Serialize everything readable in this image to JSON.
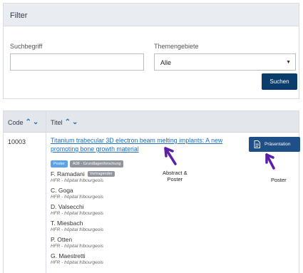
{
  "filter": {
    "title": "Filter",
    "search_label": "Suchbegriff",
    "search_value": "",
    "topic_label": "Themengebiete",
    "topic_selected": "Alle",
    "search_button": "Suchen"
  },
  "table": {
    "columns": [
      {
        "label": "Code",
        "sort_icon": "sort-up-down-icon"
      },
      {
        "label": "Titel",
        "sort_icon": "sort-up-down-icon"
      }
    ],
    "rows": [
      {
        "code": "10003",
        "title": "Titanium trabecular 3D electron beam melting implants: A new promoting bone growth material",
        "tags": [
          "Poster",
          "A08 - Grundlagenforschung"
        ],
        "authors": [
          {
            "name": "F. Ramadani",
            "badge": "Vortragender",
            "affiliation": "HFR - hôpital fribourgeois"
          },
          {
            "name": "C. Goga",
            "badge": "",
            "affiliation": "HFR - hôpital fribourgeois"
          },
          {
            "name": "D. Valsecchi",
            "badge": "",
            "affiliation": "HFR - hôpital fribourgeois"
          },
          {
            "name": "T. Miesbach",
            "badge": "",
            "affiliation": "HFR - hôpital fribourgeois"
          },
          {
            "name": "P. Otten",
            "badge": "",
            "affiliation": "HFR - hôpital fribourgeois"
          },
          {
            "name": "G. Maestretti",
            "badge": "",
            "affiliation": "HFR - hôpital fribourgeois"
          }
        ],
        "action_button": "Präsentation",
        "action_icon": "document-icon"
      }
    ]
  },
  "annotations": {
    "abstract_note_line1": "Abstract &",
    "abstract_note_line2": "Poster",
    "poster_note": "Poster",
    "arrow_color": "#5b1fa8"
  },
  "colors": {
    "primary_button": "#0b3d6b",
    "link": "#1b6ec2",
    "header_bg": "#e9edf2"
  }
}
